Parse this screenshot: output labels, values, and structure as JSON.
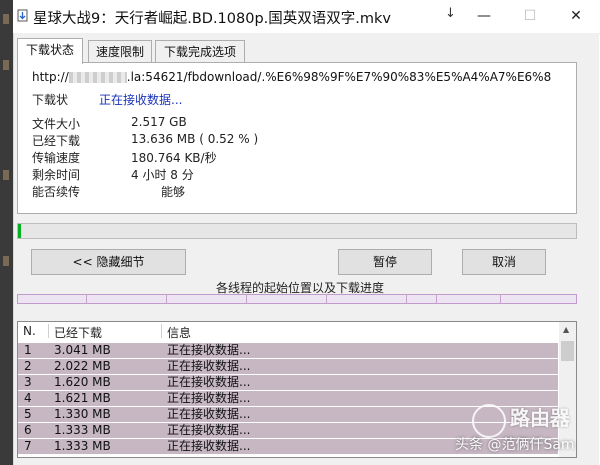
{
  "window": {
    "title": "星球大战9：天行者崛起.BD.1080p.国英双语双字.mkv",
    "download_icon": "↓",
    "controls": {
      "minimize": "—",
      "maximize": "☐",
      "close": "✕"
    }
  },
  "tabs": [
    {
      "label": "下载状态",
      "active": true
    },
    {
      "label": "速度限制",
      "active": false
    },
    {
      "label": "下载完成选项",
      "active": false
    }
  ],
  "status": {
    "url_prefix": "http://",
    "url_suffix": ".la:54621/fbdownload/.%E6%98%9F%E7%90%83%E5%A4%A7%E6%8",
    "state_label": "下载状",
    "state_value": "正在接收数据...",
    "fields": [
      {
        "label": "文件大小",
        "value": "2.517  GB"
      },
      {
        "label": "已经下载",
        "value": "13.636  MB  ( 0.52 % )"
      },
      {
        "label": "传输速度",
        "value": "180.764  KB/秒"
      },
      {
        "label": "剩余时间",
        "value": "4  小时  8  分"
      },
      {
        "label": "能否续传",
        "value": "能够"
      }
    ]
  },
  "progress": {
    "fraction": 0.0052
  },
  "buttons": {
    "hide_details": "<< 隐藏细节",
    "pause": "暂停",
    "cancel": "取消"
  },
  "threads_caption": "各线程的起始位置以及下载进度",
  "thread_list": {
    "headers": [
      "N.",
      "已经下载",
      "信息"
    ],
    "rows": [
      {
        "n": "1",
        "downloaded": "3.041  MB",
        "info": "正在接收数据..."
      },
      {
        "n": "2",
        "downloaded": "2.022  MB",
        "info": "正在接收数据..."
      },
      {
        "n": "3",
        "downloaded": "1.620  MB",
        "info": "正在接收数据..."
      },
      {
        "n": "4",
        "downloaded": "1.621  MB",
        "info": "正在接收数据..."
      },
      {
        "n": "5",
        "downloaded": "1.330  MB",
        "info": "正在接收数据..."
      },
      {
        "n": "6",
        "downloaded": "1.333  MB",
        "info": "正在接收数据..."
      },
      {
        "n": "7",
        "downloaded": "1.333  MB",
        "info": "正在接收数据..."
      }
    ]
  },
  "watermark": {
    "brand": "路由器",
    "author": "头条 @范俩仟Sam"
  },
  "colors": {
    "row_highlight": "#c6b7c3",
    "status_text": "#1a32b8",
    "segment_bar": "#c29acb"
  }
}
